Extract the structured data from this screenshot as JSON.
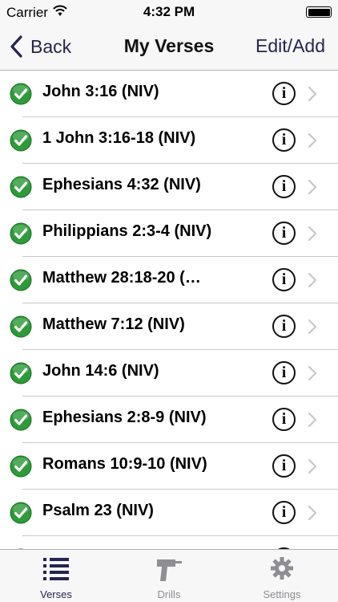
{
  "status_bar": {
    "carrier": "Carrier",
    "time": "4:32 PM",
    "battery_level": 1.0
  },
  "nav": {
    "back_label": "Back",
    "title": "My Verses",
    "edit_label": "Edit/Add"
  },
  "verses": [
    {
      "label": "John 3:16 (NIV)"
    },
    {
      "label": "1 John 3:16-18 (NIV)"
    },
    {
      "label": "Ephesians 4:32 (NIV)"
    },
    {
      "label": "Philippians 2:3-4 (NIV)"
    },
    {
      "label": "Matthew 28:18-20 (…"
    },
    {
      "label": "Matthew 7:12 (NIV)"
    },
    {
      "label": "John 14:6 (NIV)"
    },
    {
      "label": "Ephesians 2:8-9 (NIV)"
    },
    {
      "label": "Romans 10:9-10 (NIV)"
    },
    {
      "label": "Psalm 23 (NIV)"
    },
    {
      "label": ""
    }
  ],
  "row_icons": {
    "status": "green-check-icon",
    "info": "info-icon",
    "disclosure": "chevron-right-icon",
    "info_glyph": "i"
  },
  "tabs": [
    {
      "label": "Verses",
      "icon": "list-icon",
      "active": true
    },
    {
      "label": "Drills",
      "icon": "drill-icon",
      "active": false
    },
    {
      "label": "Settings",
      "icon": "gear-icon",
      "active": false
    }
  ],
  "colors": {
    "accent": "#252550",
    "check_green": "#2e9a3a",
    "inactive_tab": "#8e8e93",
    "bar_background": "#f7f7f7"
  }
}
